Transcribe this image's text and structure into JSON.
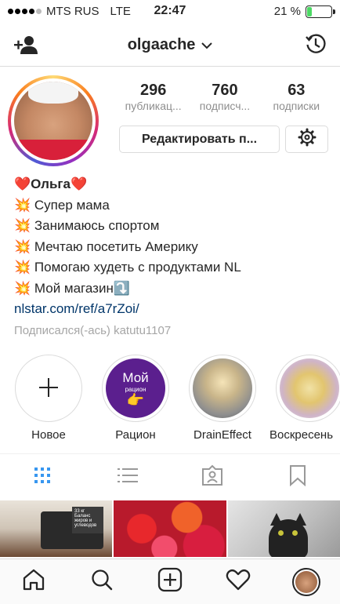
{
  "status_bar": {
    "carrier": "MTS RUS",
    "network": "LTE",
    "time": "22:47",
    "battery": "21 %",
    "battery_level": 0.21
  },
  "header": {
    "username": "olgaache",
    "dropdown_icon": "chevron-down-icon",
    "left_icon": "add-user-icon",
    "right_icon": "archive-history-icon"
  },
  "profile": {
    "stats": [
      {
        "value": "296",
        "label": "публикац..."
      },
      {
        "value": "760",
        "label": "подписч..."
      },
      {
        "value": "63",
        "label": "подписки"
      }
    ],
    "edit_button": "Редактировать п...",
    "settings_icon": "gear-icon"
  },
  "bio": {
    "name": "❤️Ольга❤️",
    "lines": [
      "💥 Супер мама",
      "💥 Занимаюсь спортом",
      "💥 Мечтаю посетить Америку",
      "💥 Помогаю худеть с продуктами NL",
      "💥 Мой магазин⤵️"
    ],
    "link": "nlstar.com/ref/a7rZoi/",
    "followed_by": "Подписался(-ась) katutu1107"
  },
  "stories": {
    "new_label": "Новое",
    "items": [
      {
        "label": "Рацион",
        "cover_text": "Мой",
        "cover_subtext": "рацион"
      },
      {
        "label": "DrainEffect"
      },
      {
        "label": "Воскресень"
      }
    ]
  },
  "tabs": {
    "items": [
      "grid-icon",
      "list-icon",
      "tagged-icon",
      "saved-icon"
    ],
    "active": 0,
    "active_color": "#3897f0"
  },
  "grid": {
    "sign_text": "33 кг Баланс жиров и углеводов"
  },
  "bottom_nav": {
    "items": [
      "home-icon",
      "search-icon",
      "new-post-icon",
      "activity-icon",
      "profile-avatar"
    ]
  }
}
